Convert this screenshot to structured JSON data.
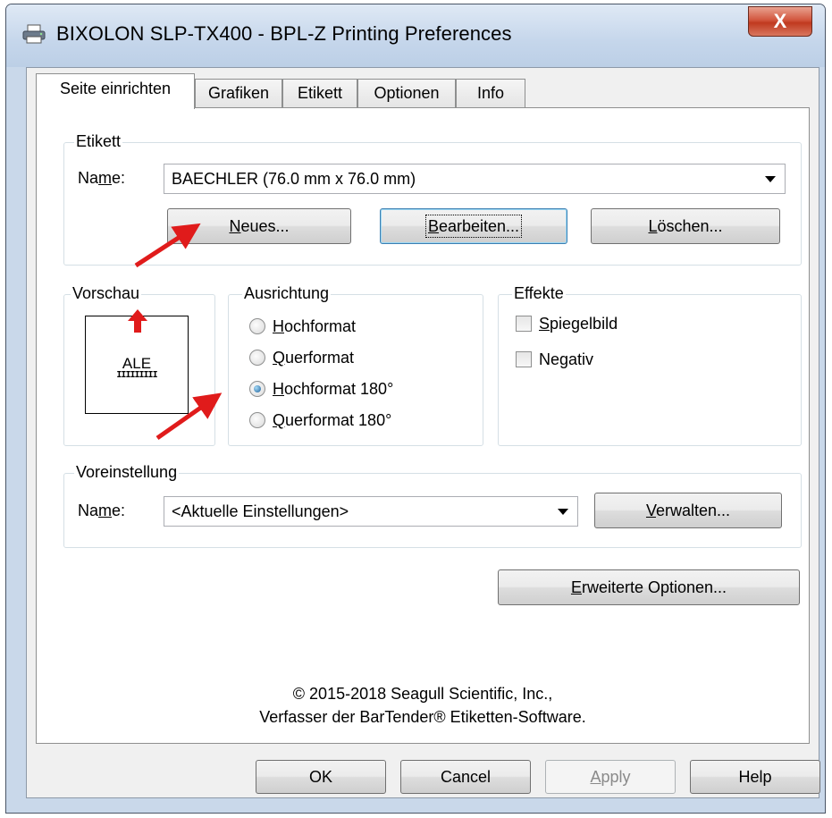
{
  "window": {
    "title": "BIXOLON SLP-TX400 - BPL-Z Printing Preferences",
    "close_symbol": "X",
    "printer_icon": "printer-icon"
  },
  "tabs": [
    {
      "label": "Seite einrichten",
      "active": true
    },
    {
      "label": "Grafiken"
    },
    {
      "label": "Etikett"
    },
    {
      "label": "Optionen"
    },
    {
      "label": "Info"
    }
  ],
  "etikett": {
    "group_label": "Etikett",
    "name_prefix": "Na",
    "name_hotkey": "m",
    "name_suffix": "e:",
    "selected": "BAECHLER (76.0 mm x 76.0 mm)",
    "btn_new": {
      "hotkey": "N",
      "rest": "eues..."
    },
    "btn_edit": {
      "hotkey": "B",
      "rest": "earbeiten..."
    },
    "btn_delete": {
      "hotkey": "L",
      "rest": "öschen..."
    }
  },
  "vorschau": {
    "group_label": "Vorschau",
    "sample_text": "ALE",
    "sample_barcode": "IIIIIIIII"
  },
  "ausrichtung": {
    "group_label": "Ausrichtung",
    "options": [
      {
        "hotkey": "H",
        "rest": "ochformat",
        "checked": false
      },
      {
        "hotkey": "Q",
        "rest": "uerformat",
        "checked": false
      },
      {
        "hotkey": "H",
        "rest": "ochformat 180°",
        "checked": true
      },
      {
        "hotkey": "Q",
        "rest": "uerformat 180°",
        "checked": false
      }
    ]
  },
  "effekte": {
    "group_label": "Effekte",
    "mirror": {
      "hotkey": "S",
      "rest": "piegelbild",
      "checked": false
    },
    "negative_prefix": "Ne",
    "negative_hotkey": "g",
    "negative_suffix": "ativ",
    "negative_checked": false
  },
  "voreinstellung": {
    "group_label": "Voreinstellung",
    "name_prefix": "Na",
    "name_hotkey": "m",
    "name_suffix": "e:",
    "selected": "<Aktuelle Einstellungen>",
    "btn_manage": {
      "hotkey": "V",
      "rest": "erwalten..."
    }
  },
  "advanced": {
    "hotkey": "E",
    "rest": "rweiterte Optionen..."
  },
  "copyright": {
    "line1": "© 2015-2018 Seagull Scientific, Inc.,",
    "line2": "Verfasser der BarTender® Etiketten-Software."
  },
  "footer": {
    "ok": "OK",
    "cancel": "Cancel",
    "apply_hotkey": "A",
    "apply_rest": "pply",
    "help": "Help"
  },
  "colors": {
    "annotation_arrow": "#e01b1b",
    "radio_selected": "#1c5f9a",
    "focus_border": "#3c7fb1"
  }
}
